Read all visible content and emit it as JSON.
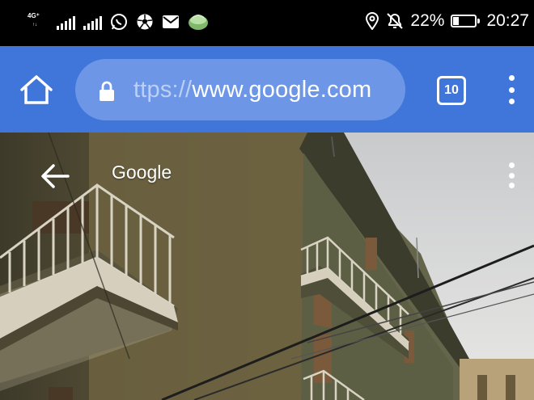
{
  "status_bar": {
    "network_type": "4G⁺",
    "network_sub": "↑↓",
    "icons": [
      "signal-icon",
      "whatsapp-icon",
      "soccer-ball-icon",
      "mail-icon",
      "notification-app-icon",
      "location-icon",
      "mute-icon",
      "battery-icon"
    ],
    "battery_percent": "22%",
    "battery_level": 0.22,
    "time": "20:27"
  },
  "toolbar": {
    "url_scheme": "ttps://",
    "url_host": "www.google.com",
    "tab_count": "10"
  },
  "page": {
    "title": "Google"
  },
  "colors": {
    "toolbar": "#4075d9",
    "url_box": "#6d97e6",
    "status_bar": "#000000"
  }
}
